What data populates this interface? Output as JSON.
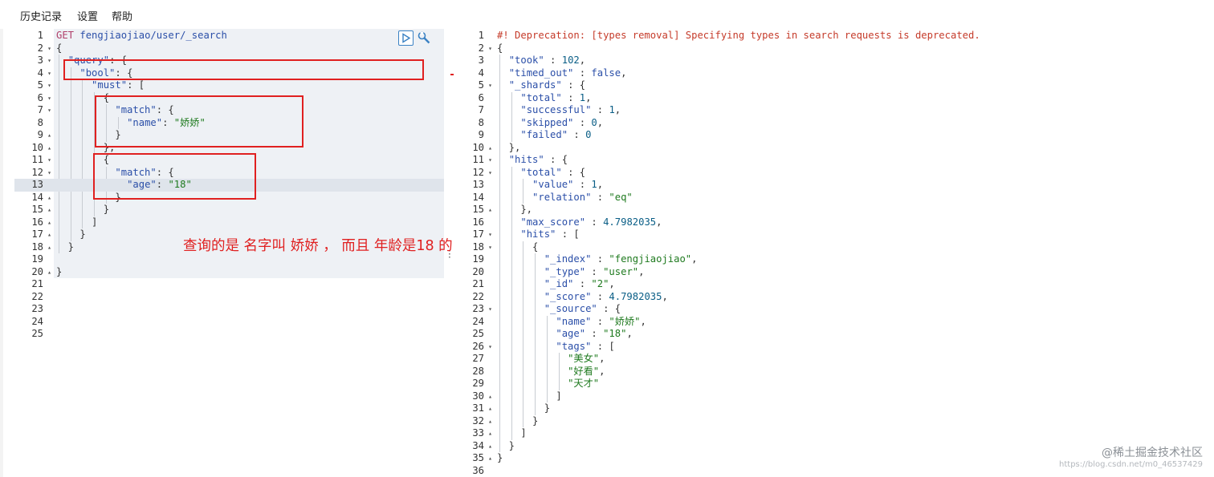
{
  "menu": {
    "history": "历史记录",
    "settings": "设置",
    "help": "帮助"
  },
  "request": {
    "lines": [
      {
        "n": "1",
        "fold": "",
        "active": false,
        "tokens": [
          [
            "k-method",
            "GET "
          ],
          [
            "k-path",
            "fengjiaojiao/user/_search"
          ]
        ]
      },
      {
        "n": "2",
        "fold": "▾",
        "active": false,
        "tokens": [
          [
            "k-punc",
            "{"
          ]
        ]
      },
      {
        "n": "3",
        "fold": "▾",
        "active": false,
        "tokens": [
          [
            "k-punc",
            "  "
          ],
          [
            "k-key",
            "\"query\""
          ],
          [
            "k-punc",
            ": {"
          ]
        ]
      },
      {
        "n": "4",
        "fold": "▾",
        "active": false,
        "tokens": [
          [
            "k-punc",
            "    "
          ],
          [
            "k-key",
            "\"bool\""
          ],
          [
            "k-punc",
            ": {"
          ]
        ]
      },
      {
        "n": "5",
        "fold": "▾",
        "active": false,
        "tokens": [
          [
            "k-punc",
            "      "
          ],
          [
            "k-key",
            "\"must\""
          ],
          [
            "k-punc",
            ": ["
          ]
        ]
      },
      {
        "n": "6",
        "fold": "▾",
        "active": false,
        "tokens": [
          [
            "k-punc",
            "        {"
          ]
        ]
      },
      {
        "n": "7",
        "fold": "▾",
        "active": false,
        "tokens": [
          [
            "k-punc",
            "          "
          ],
          [
            "k-key",
            "\"match\""
          ],
          [
            "k-punc",
            ": {"
          ]
        ]
      },
      {
        "n": "8",
        "fold": "",
        "active": false,
        "tokens": [
          [
            "k-punc",
            "            "
          ],
          [
            "k-key",
            "\"name\""
          ],
          [
            "k-punc",
            ": "
          ],
          [
            "k-str",
            "\"娇娇\""
          ]
        ]
      },
      {
        "n": "9",
        "fold": "▴",
        "active": false,
        "tokens": [
          [
            "k-punc",
            "          }"
          ]
        ]
      },
      {
        "n": "10",
        "fold": "▴",
        "active": false,
        "tokens": [
          [
            "k-punc",
            "        },"
          ]
        ]
      },
      {
        "n": "11",
        "fold": "▾",
        "active": false,
        "tokens": [
          [
            "k-punc",
            "        {"
          ]
        ]
      },
      {
        "n": "12",
        "fold": "▾",
        "active": false,
        "tokens": [
          [
            "k-punc",
            "          "
          ],
          [
            "k-key",
            "\"match\""
          ],
          [
            "k-punc",
            ": {"
          ]
        ]
      },
      {
        "n": "13",
        "fold": "",
        "active": true,
        "tokens": [
          [
            "k-punc",
            "            "
          ],
          [
            "k-key",
            "\"age\""
          ],
          [
            "k-punc",
            ": "
          ],
          [
            "k-str",
            "\"18\""
          ]
        ]
      },
      {
        "n": "14",
        "fold": "▴",
        "active": false,
        "tokens": [
          [
            "k-punc",
            "          }"
          ]
        ]
      },
      {
        "n": "15",
        "fold": "▴",
        "active": false,
        "tokens": [
          [
            "k-punc",
            "        }"
          ]
        ]
      },
      {
        "n": "16",
        "fold": "▴",
        "active": false,
        "tokens": [
          [
            "k-punc",
            "      ]"
          ]
        ]
      },
      {
        "n": "17",
        "fold": "▴",
        "active": false,
        "tokens": [
          [
            "k-punc",
            "    }"
          ]
        ]
      },
      {
        "n": "18",
        "fold": "▴",
        "active": false,
        "tokens": [
          [
            "k-punc",
            "  }"
          ]
        ]
      },
      {
        "n": "19",
        "fold": "",
        "active": false,
        "tokens": []
      },
      {
        "n": "20",
        "fold": "▴",
        "active": false,
        "tokens": [
          [
            "k-punc",
            "}"
          ]
        ]
      },
      {
        "n": "21",
        "fold": "",
        "active": false,
        "tokens": []
      },
      {
        "n": "22",
        "fold": "",
        "active": false,
        "tokens": []
      },
      {
        "n": "23",
        "fold": "",
        "active": false,
        "tokens": []
      },
      {
        "n": "24",
        "fold": "",
        "active": false,
        "tokens": []
      },
      {
        "n": "25",
        "fold": "",
        "active": false,
        "tokens": []
      }
    ]
  },
  "response": {
    "lines": [
      {
        "n": "1",
        "fold": "",
        "tokens": [
          [
            "k-comment",
            "#! Deprecation: [types removal] Specifying types in search requests is deprecated."
          ]
        ]
      },
      {
        "n": "2",
        "fold": "▾",
        "tokens": [
          [
            "k-punc",
            "{"
          ]
        ]
      },
      {
        "n": "3",
        "fold": "",
        "tokens": [
          [
            "k-punc",
            "  "
          ],
          [
            "k-key",
            "\"took\""
          ],
          [
            "k-punc",
            " : "
          ],
          [
            "k-num",
            "102"
          ],
          [
            "k-punc",
            ","
          ]
        ]
      },
      {
        "n": "4",
        "fold": "",
        "tokens": [
          [
            "k-punc",
            "  "
          ],
          [
            "k-key",
            "\"timed_out\""
          ],
          [
            "k-punc",
            " : "
          ],
          [
            "k-bool",
            "false"
          ],
          [
            "k-punc",
            ","
          ]
        ]
      },
      {
        "n": "5",
        "fold": "▾",
        "tokens": [
          [
            "k-punc",
            "  "
          ],
          [
            "k-key",
            "\"_shards\""
          ],
          [
            "k-punc",
            " : {"
          ]
        ]
      },
      {
        "n": "6",
        "fold": "",
        "tokens": [
          [
            "k-punc",
            "    "
          ],
          [
            "k-key",
            "\"total\""
          ],
          [
            "k-punc",
            " : "
          ],
          [
            "k-num",
            "1"
          ],
          [
            "k-punc",
            ","
          ]
        ]
      },
      {
        "n": "7",
        "fold": "",
        "tokens": [
          [
            "k-punc",
            "    "
          ],
          [
            "k-key",
            "\"successful\""
          ],
          [
            "k-punc",
            " : "
          ],
          [
            "k-num",
            "1"
          ],
          [
            "k-punc",
            ","
          ]
        ]
      },
      {
        "n": "8",
        "fold": "",
        "tokens": [
          [
            "k-punc",
            "    "
          ],
          [
            "k-key",
            "\"skipped\""
          ],
          [
            "k-punc",
            " : "
          ],
          [
            "k-num",
            "0"
          ],
          [
            "k-punc",
            ","
          ]
        ]
      },
      {
        "n": "9",
        "fold": "",
        "tokens": [
          [
            "k-punc",
            "    "
          ],
          [
            "k-key",
            "\"failed\""
          ],
          [
            "k-punc",
            " : "
          ],
          [
            "k-num",
            "0"
          ]
        ]
      },
      {
        "n": "10",
        "fold": "▴",
        "tokens": [
          [
            "k-punc",
            "  },"
          ]
        ]
      },
      {
        "n": "11",
        "fold": "▾",
        "tokens": [
          [
            "k-punc",
            "  "
          ],
          [
            "k-key",
            "\"hits\""
          ],
          [
            "k-punc",
            " : {"
          ]
        ]
      },
      {
        "n": "12",
        "fold": "▾",
        "tokens": [
          [
            "k-punc",
            "    "
          ],
          [
            "k-key",
            "\"total\""
          ],
          [
            "k-punc",
            " : {"
          ]
        ]
      },
      {
        "n": "13",
        "fold": "",
        "tokens": [
          [
            "k-punc",
            "      "
          ],
          [
            "k-key",
            "\"value\""
          ],
          [
            "k-punc",
            " : "
          ],
          [
            "k-num",
            "1"
          ],
          [
            "k-punc",
            ","
          ]
        ]
      },
      {
        "n": "14",
        "fold": "",
        "tokens": [
          [
            "k-punc",
            "      "
          ],
          [
            "k-key",
            "\"relation\""
          ],
          [
            "k-punc",
            " : "
          ],
          [
            "k-str",
            "\"eq\""
          ]
        ]
      },
      {
        "n": "15",
        "fold": "▴",
        "tokens": [
          [
            "k-punc",
            "    },"
          ]
        ]
      },
      {
        "n": "16",
        "fold": "",
        "tokens": [
          [
            "k-punc",
            "    "
          ],
          [
            "k-key",
            "\"max_score\""
          ],
          [
            "k-punc",
            " : "
          ],
          [
            "k-num",
            "4.7982035"
          ],
          [
            "k-punc",
            ","
          ]
        ]
      },
      {
        "n": "17",
        "fold": "▾",
        "tokens": [
          [
            "k-punc",
            "    "
          ],
          [
            "k-key",
            "\"hits\""
          ],
          [
            "k-punc",
            " : ["
          ]
        ]
      },
      {
        "n": "18",
        "fold": "▾",
        "tokens": [
          [
            "k-punc",
            "      {"
          ]
        ]
      },
      {
        "n": "19",
        "fold": "",
        "tokens": [
          [
            "k-punc",
            "        "
          ],
          [
            "k-key",
            "\"_index\""
          ],
          [
            "k-punc",
            " : "
          ],
          [
            "k-str",
            "\"fengjiaojiao\""
          ],
          [
            "k-punc",
            ","
          ]
        ]
      },
      {
        "n": "20",
        "fold": "",
        "tokens": [
          [
            "k-punc",
            "        "
          ],
          [
            "k-key",
            "\"_type\""
          ],
          [
            "k-punc",
            " : "
          ],
          [
            "k-str",
            "\"user\""
          ],
          [
            "k-punc",
            ","
          ]
        ]
      },
      {
        "n": "21",
        "fold": "",
        "tokens": [
          [
            "k-punc",
            "        "
          ],
          [
            "k-key",
            "\"_id\""
          ],
          [
            "k-punc",
            " : "
          ],
          [
            "k-str",
            "\"2\""
          ],
          [
            "k-punc",
            ","
          ]
        ]
      },
      {
        "n": "22",
        "fold": "",
        "tokens": [
          [
            "k-punc",
            "        "
          ],
          [
            "k-key",
            "\"_score\""
          ],
          [
            "k-punc",
            " : "
          ],
          [
            "k-num",
            "4.7982035"
          ],
          [
            "k-punc",
            ","
          ]
        ]
      },
      {
        "n": "23",
        "fold": "▾",
        "tokens": [
          [
            "k-punc",
            "        "
          ],
          [
            "k-key",
            "\"_source\""
          ],
          [
            "k-punc",
            " : {"
          ]
        ]
      },
      {
        "n": "24",
        "fold": "",
        "tokens": [
          [
            "k-punc",
            "          "
          ],
          [
            "k-key",
            "\"name\""
          ],
          [
            "k-punc",
            " : "
          ],
          [
            "k-str",
            "\"娇娇\""
          ],
          [
            "k-punc",
            ","
          ]
        ]
      },
      {
        "n": "25",
        "fold": "",
        "tokens": [
          [
            "k-punc",
            "          "
          ],
          [
            "k-key",
            "\"age\""
          ],
          [
            "k-punc",
            " : "
          ],
          [
            "k-str",
            "\"18\""
          ],
          [
            "k-punc",
            ","
          ]
        ]
      },
      {
        "n": "26",
        "fold": "▾",
        "tokens": [
          [
            "k-punc",
            "          "
          ],
          [
            "k-key",
            "\"tags\""
          ],
          [
            "k-punc",
            " : ["
          ]
        ]
      },
      {
        "n": "27",
        "fold": "",
        "tokens": [
          [
            "k-punc",
            "            "
          ],
          [
            "k-str",
            "\"美女\""
          ],
          [
            "k-punc",
            ","
          ]
        ]
      },
      {
        "n": "28",
        "fold": "",
        "tokens": [
          [
            "k-punc",
            "            "
          ],
          [
            "k-str",
            "\"好看\""
          ],
          [
            "k-punc",
            ","
          ]
        ]
      },
      {
        "n": "29",
        "fold": "",
        "tokens": [
          [
            "k-punc",
            "            "
          ],
          [
            "k-str",
            "\"天才\""
          ]
        ]
      },
      {
        "n": "30",
        "fold": "▴",
        "tokens": [
          [
            "k-punc",
            "          ]"
          ]
        ]
      },
      {
        "n": "31",
        "fold": "▴",
        "tokens": [
          [
            "k-punc",
            "        }"
          ]
        ]
      },
      {
        "n": "32",
        "fold": "▴",
        "tokens": [
          [
            "k-punc",
            "      }"
          ]
        ]
      },
      {
        "n": "33",
        "fold": "▴",
        "tokens": [
          [
            "k-punc",
            "    ]"
          ]
        ]
      },
      {
        "n": "34",
        "fold": "▴",
        "tokens": [
          [
            "k-punc",
            "  }"
          ]
        ]
      },
      {
        "n": "35",
        "fold": "▴",
        "tokens": [
          [
            "k-punc",
            "}"
          ]
        ]
      },
      {
        "n": "36",
        "fold": "",
        "tokens": []
      }
    ]
  },
  "annotation": {
    "text": "查询的是 名字叫 娇娇 ， 而且 年龄是18 的"
  },
  "watermark": {
    "main": "@稀土掘金技术社区",
    "sub": "https://blog.csdn.net/m0_46537429"
  },
  "icons": {
    "run": "play-icon",
    "wrench": "wrench-icon"
  },
  "colors": {
    "annotation": "#e02020",
    "key": "#2b4fa8",
    "string": "#1f7a1f",
    "comment": "#c53b2a"
  }
}
